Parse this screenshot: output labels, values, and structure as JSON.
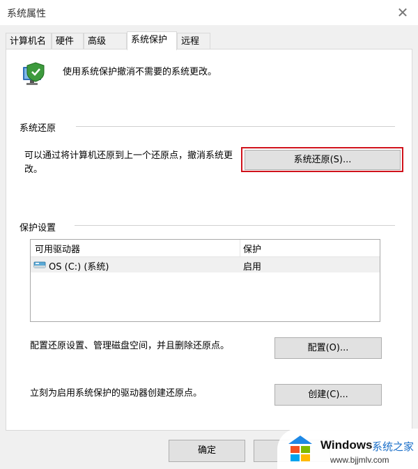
{
  "window": {
    "title": "系统属性",
    "close_glyph": "✕"
  },
  "tabs": [
    {
      "label": "计算机名"
    },
    {
      "label": "硬件"
    },
    {
      "label": "高级"
    },
    {
      "label": "系统保护",
      "active": true
    },
    {
      "label": "远程"
    }
  ],
  "intro": {
    "text": "使用系统保护撤消不需要的系统更改。",
    "icon": "system-protection-shield-icon"
  },
  "restore_section": {
    "label": "系统还原",
    "description": "可以通过将计算机还原到上一个还原点，撤消系统更改。",
    "button_label": "系统还原(S)...",
    "highlight_color": "#d0121b"
  },
  "protection_section": {
    "label": "保护设置",
    "columns": [
      "可用驱动器",
      "保护"
    ],
    "rows": [
      {
        "drive": "OS (C:) (系统)",
        "protection": "启用",
        "icon": "drive-icon"
      }
    ],
    "configure_text": "配置还原设置、管理磁盘空间，并且删除还原点。",
    "configure_button": "配置(O)...",
    "create_text": "立刻为启用系统保护的驱动器创建还原点。",
    "create_button": "创建(C)..."
  },
  "footer": {
    "ok_label": "确定",
    "cancel_label": ""
  },
  "watermark": {
    "name": "Windows",
    "chinese": "系统之家",
    "url": "www.bjjmlv.com"
  }
}
